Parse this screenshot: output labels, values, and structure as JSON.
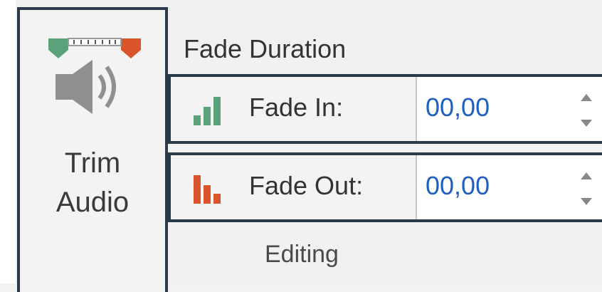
{
  "trim_audio": {
    "line1": "Trim",
    "line2": "Audio",
    "icon": "trim-audio-icon"
  },
  "fade_duration": {
    "title": "Fade Duration",
    "fade_in": {
      "label": "Fade In:",
      "value": "00,00",
      "icon": "fade-in-icon"
    },
    "fade_out": {
      "label": "Fade Out:",
      "value": "00,00",
      "icon": "fade-out-icon"
    }
  },
  "group": {
    "label": "Editing"
  },
  "colors": {
    "green": "#5aa37a",
    "red": "#d9542b",
    "border": "#2b3a4a",
    "value_text": "#1f5fbf"
  }
}
